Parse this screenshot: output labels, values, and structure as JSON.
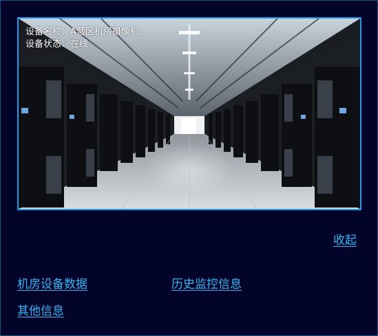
{
  "camera": {
    "device_name_label": "设备名称：",
    "device_name_value": "A营区机房摄像机",
    "device_status_label": "设备状态：",
    "device_status_value": "在线"
  },
  "actions": {
    "collapse_label": "收起"
  },
  "nav": {
    "items": [
      {
        "label": "机房设备数据"
      },
      {
        "label": "历史监控信息"
      },
      {
        "label": "其他信息"
      }
    ]
  },
  "colors": {
    "background": "#02042a",
    "frame_border": "#1e9ae8",
    "link": "#36b6f2",
    "overlay_text": "#ffffff"
  }
}
